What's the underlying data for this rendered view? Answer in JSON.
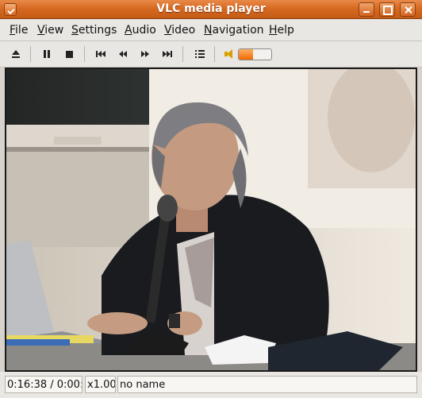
{
  "window": {
    "title": "VLC media player"
  },
  "menu": {
    "items": [
      "File",
      "View",
      "Settings",
      "Audio",
      "Video",
      "Navigation",
      "Help"
    ]
  },
  "toolbar": {
    "buttons": [
      {
        "name": "eject",
        "icon": "eject-icon"
      },
      {
        "name": "pause",
        "icon": "pause-icon"
      },
      {
        "name": "stop",
        "icon": "stop-icon"
      },
      {
        "name": "previous",
        "icon": "skip-previous-icon"
      },
      {
        "name": "rewind",
        "icon": "rewind-icon"
      },
      {
        "name": "forward",
        "icon": "fast-forward-icon"
      },
      {
        "name": "next",
        "icon": "skip-next-icon"
      },
      {
        "name": "playlist",
        "icon": "playlist-icon"
      },
      {
        "name": "mute",
        "icon": "speaker-icon"
      }
    ],
    "volume_level": 0.45,
    "accent_color": "#f26a00"
  },
  "status": {
    "time": "0:16:38 / 0:00:",
    "speed": "x1.00",
    "title": "no name"
  },
  "colors": {
    "titlebar": "#d86a22",
    "menubar": "#e9e7e3"
  }
}
